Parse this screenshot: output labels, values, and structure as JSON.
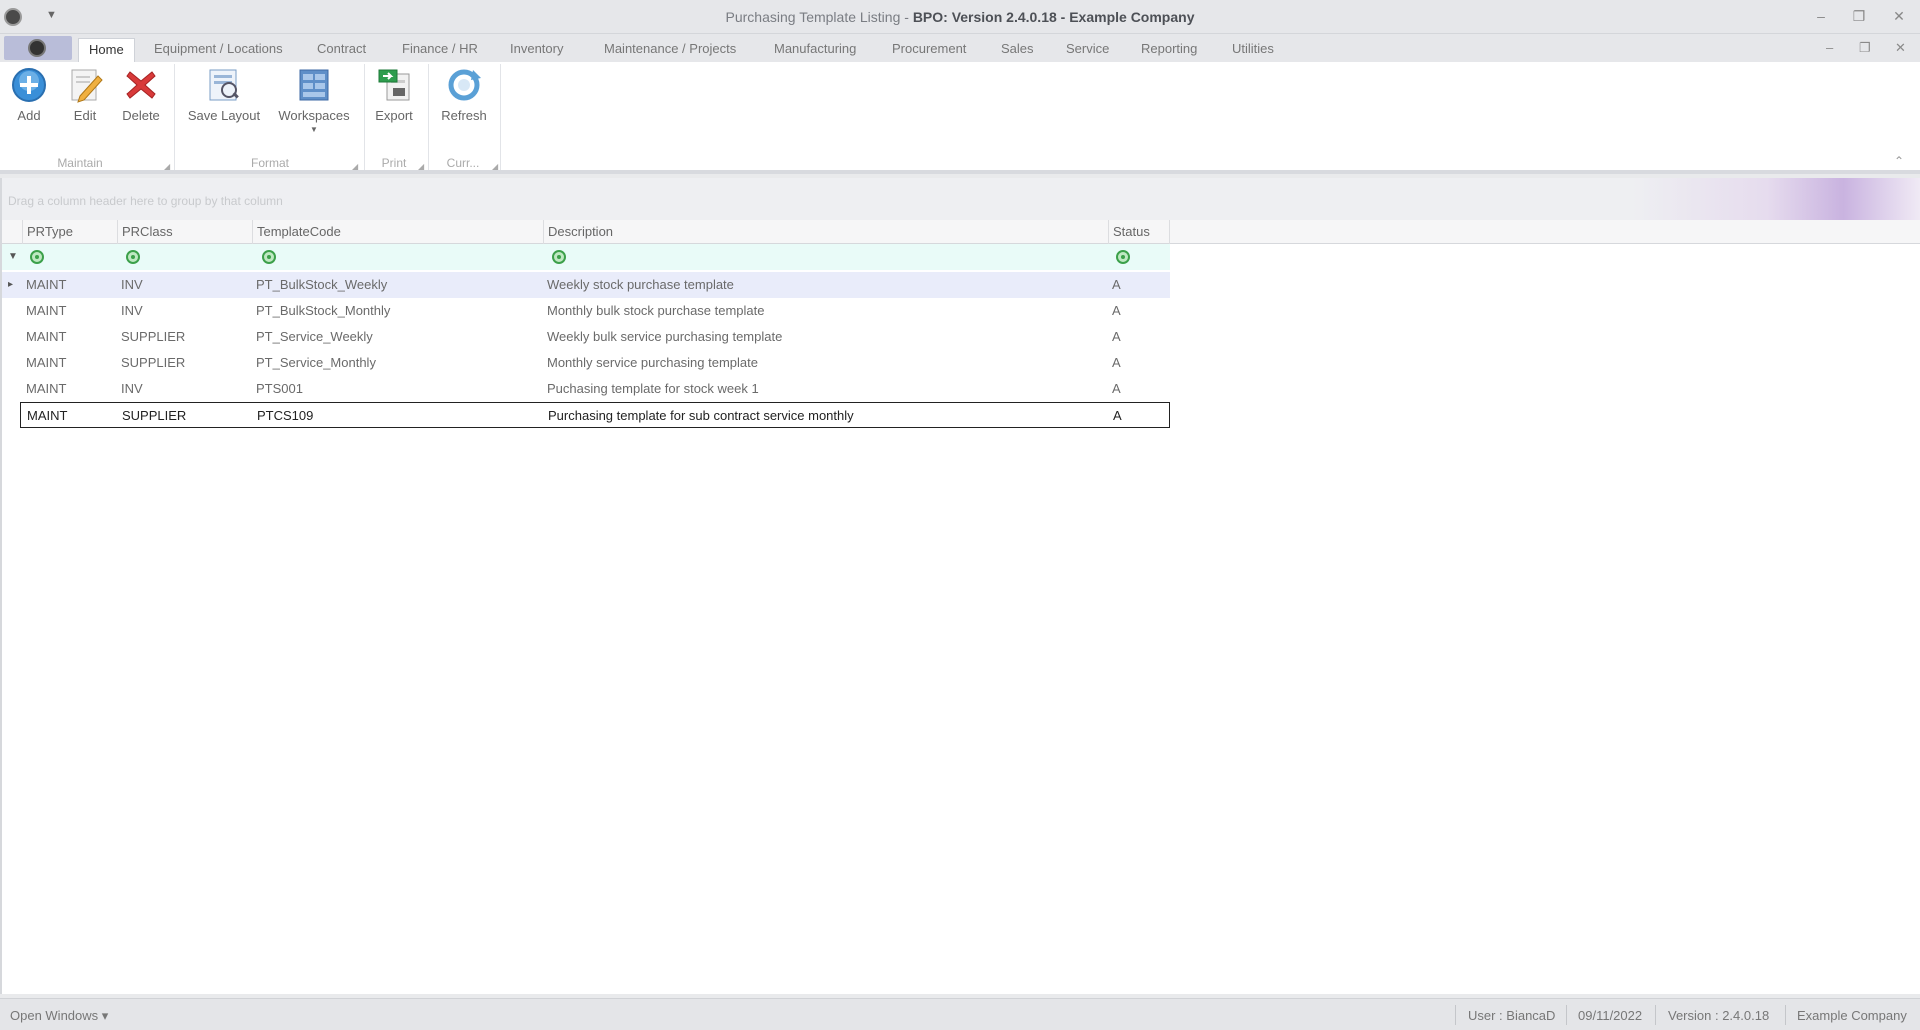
{
  "window": {
    "title_prefix": "Purchasing Template Listing - ",
    "title_bold": "BPO: Version 2.4.0.18 - Example Company",
    "minimize": "–",
    "restore": "❐",
    "close": "✕"
  },
  "tabs": [
    "Home",
    "Equipment / Locations",
    "Contract",
    "Finance / HR",
    "Inventory",
    "Maintenance / Projects",
    "Manufacturing",
    "Procurement",
    "Sales",
    "Service",
    "Reporting",
    "Utilities"
  ],
  "ribbon": {
    "buttons": {
      "add": "Add",
      "edit": "Edit",
      "delete": "Delete",
      "save_layout": "Save Layout",
      "workspaces": "Workspaces",
      "export": "Export",
      "refresh": "Refresh"
    },
    "groups": {
      "maintain": "Maintain",
      "format": "Format",
      "print": "Print",
      "curr": "Curr..."
    }
  },
  "grid": {
    "group_hint": "Drag a column header here to group by that column",
    "columns": [
      "PRType",
      "PRClass",
      "TemplateCode",
      "Description",
      "Status"
    ],
    "rows": [
      [
        "MAINT",
        "INV",
        "PT_BulkStock_Weekly",
        "Weekly stock purchase template",
        "A"
      ],
      [
        "MAINT",
        "INV",
        "PT_BulkStock_Monthly",
        "Monthly bulk stock purchase template",
        "A"
      ],
      [
        "MAINT",
        "SUPPLIER",
        "PT_Service_Weekly",
        "Weekly bulk service purchasing template",
        "A"
      ],
      [
        "MAINT",
        "SUPPLIER",
        "PT_Service_Monthly",
        "Monthly service purchasing template",
        "A"
      ],
      [
        "MAINT",
        "INV",
        "PTS001",
        "Puchasing template for stock week 1",
        "A"
      ],
      [
        "MAINT",
        "SUPPLIER",
        "PTCS109",
        "Purchasing template for sub contract service monthly",
        "A"
      ]
    ]
  },
  "statusbar": {
    "open_windows": "Open Windows ▾",
    "user": "User : BiancaD",
    "date": "09/11/2022",
    "version": "Version : 2.4.0.18",
    "company": "Example Company"
  },
  "colors": {
    "filter_row": "#e9fbf8",
    "selected_row": "#e9ecfa",
    "accent_add": "#3a8fd8",
    "accent_delete": "#d83a3a"
  }
}
